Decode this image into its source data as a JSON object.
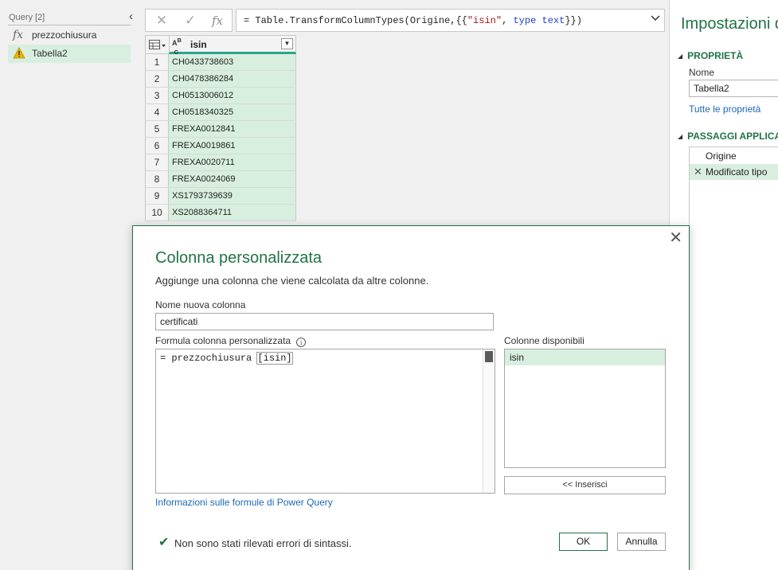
{
  "queries_pane": {
    "header": "Query [2]",
    "items": [
      {
        "label": "prezzochiusura",
        "icon": "function-icon"
      },
      {
        "label": "Tabella2",
        "icon": "warning-icon"
      }
    ]
  },
  "formula_bar": {
    "cancel_glyph": "✕",
    "commit_glyph": "✓",
    "fx_glyph": "fx",
    "formula_plain_1": "= Table.TransformColumnTypes(Origine,{{",
    "formula_str": "\"isin\"",
    "formula_plain_2": ", ",
    "formula_kw": "type",
    "formula_plain_3": " ",
    "formula_kw2": "text",
    "formula_plain_4": "}})"
  },
  "grid": {
    "column_type_icon": "ABC",
    "column_name": "isin",
    "rows": [
      {
        "n": "1",
        "isin": "CH0433738603"
      },
      {
        "n": "2",
        "isin": "CH0478386284"
      },
      {
        "n": "3",
        "isin": "CH0513006012"
      },
      {
        "n": "4",
        "isin": "CH0518340325"
      },
      {
        "n": "5",
        "isin": "FREXA0012841"
      },
      {
        "n": "6",
        "isin": "FREXA0019861"
      },
      {
        "n": "7",
        "isin": "FREXA0020711"
      },
      {
        "n": "8",
        "isin": "FREXA0024069"
      },
      {
        "n": "9",
        "isin": "XS1793739639"
      },
      {
        "n": "10",
        "isin": "XS2088364711"
      }
    ]
  },
  "settings": {
    "title": "Impostazioni query",
    "properties_header": "PROPRIETÀ",
    "name_label": "Nome",
    "name_value": "Tabella2",
    "all_properties_link": "Tutte le proprietà",
    "steps_header": "PASSAGGI APPLICATI",
    "steps": [
      {
        "label": "Origine"
      },
      {
        "label": "Modificato tipo"
      }
    ]
  },
  "dialog": {
    "title": "Colonna personalizzata",
    "description": "Aggiunge una colonna che viene calcolata da altre colonne.",
    "new_column_label": "Nome nuova colonna",
    "new_column_value": "certificati",
    "formula_label": "Formula colonna personalizzata",
    "formula_prefix": "= prezzochiusura ",
    "formula_ref": "[isin]",
    "available_columns_label": "Colonne disponibili",
    "available_columns": [
      "isin"
    ],
    "insert_button": "<< Inserisci",
    "help_link": "Informazioni sulle formule di Power Query",
    "status_message": "Non sono stati rilevati errori di sintassi.",
    "ok_button": "OK",
    "cancel_button": "Annulla"
  },
  "colors": {
    "accent": "#217346",
    "selection": "#d8efdf",
    "column_underline": "#2aa58a",
    "link": "#1d68b8",
    "warning": "#e8b400"
  }
}
